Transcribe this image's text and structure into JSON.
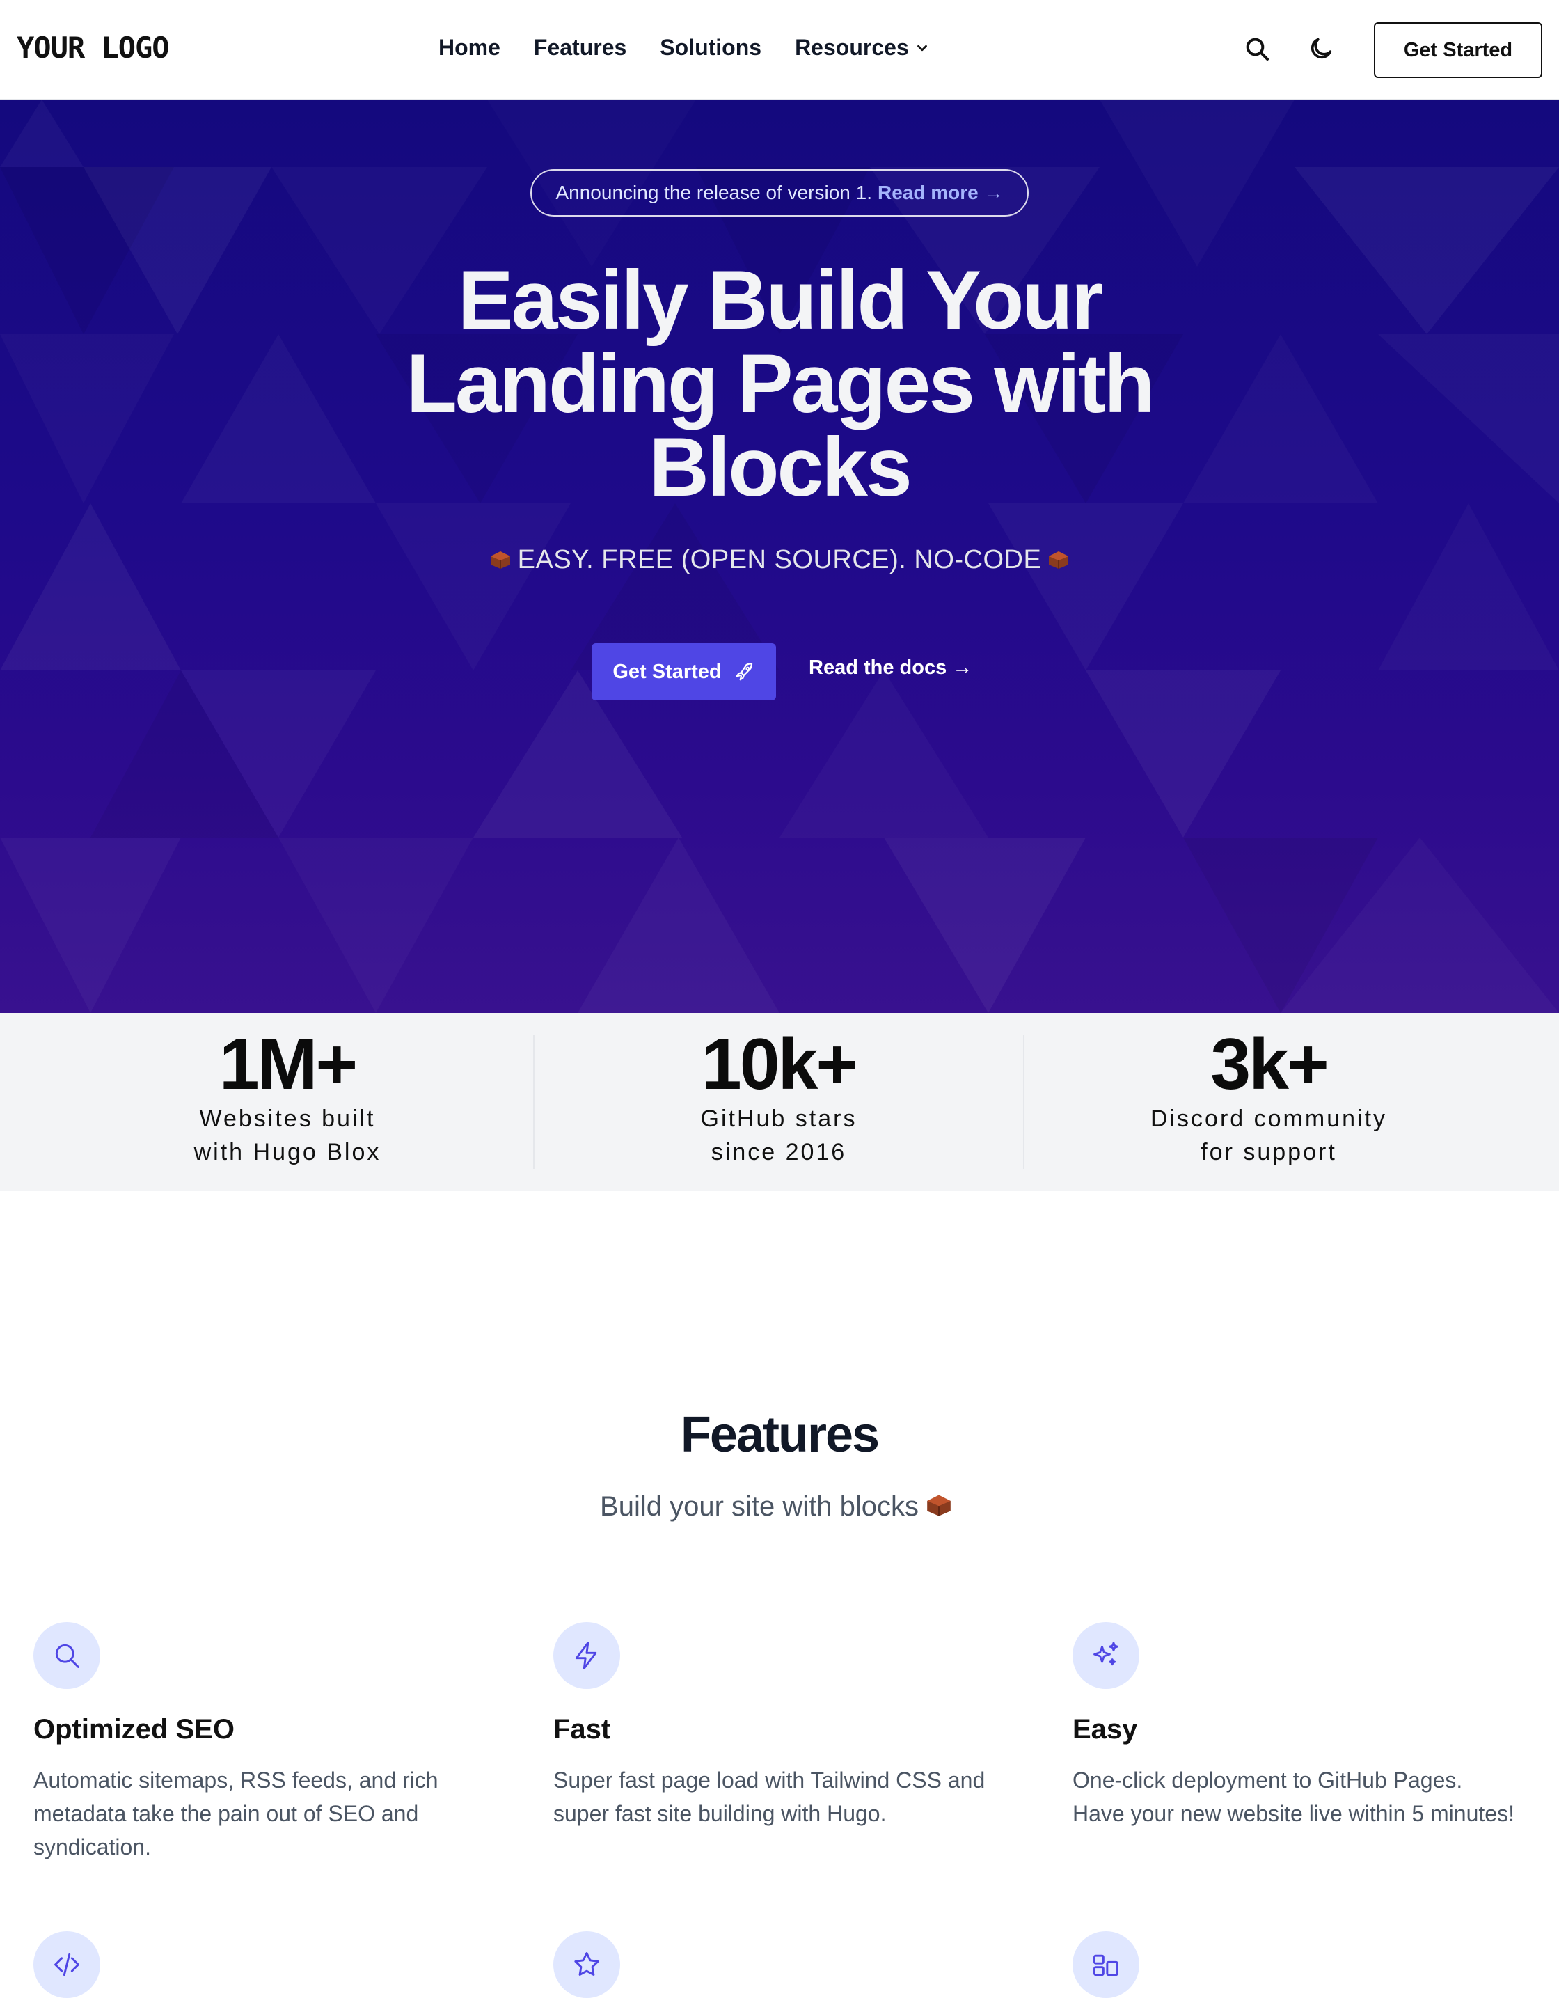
{
  "nav": {
    "logo": "YOUR LOGO",
    "menu": [
      "Home",
      "Features",
      "Solutions",
      "Resources"
    ],
    "cta": "Get Started"
  },
  "hero": {
    "announcement": "Announcing the release of version 1.",
    "announcement_link": "Read more →",
    "title": "Easily Build Your Landing Pages with Blocks",
    "tagline": "EASY. FREE (OPEN SOURCE). NO-CODE",
    "primary_cta": "Get Started",
    "secondary_cta": "Read the docs →",
    "colors": {
      "accent": "#4f46e5",
      "bg_top": "#14097e",
      "bg_bottom": "#38118f"
    }
  },
  "stats": [
    {
      "value": "1M+",
      "label": "Websites built\nwith Hugo Blox"
    },
    {
      "value": "10k+",
      "label": "GitHub stars\nsince 2016"
    },
    {
      "value": "3k+",
      "label": "Discord community\nfor support"
    }
  ],
  "features": {
    "title": "Features",
    "subtitle": "Build your site with blocks",
    "items": [
      {
        "icon": "magnifying-glass-icon",
        "title": "Optimized SEO",
        "text": "Automatic sitemaps, RSS feeds, and rich metadata take the pain out of SEO and syndication."
      },
      {
        "icon": "bolt-icon",
        "title": "Fast",
        "text": "Super fast page load with Tailwind CSS and super fast site building with Hugo."
      },
      {
        "icon": "sparkles-icon",
        "title": "Easy",
        "text": "One-click deployment to GitHub Pages. Have your new website live within 5 minutes!"
      },
      {
        "icon": "code-icon"
      },
      {
        "icon": "star-icon"
      },
      {
        "icon": "layout-icon"
      }
    ]
  }
}
